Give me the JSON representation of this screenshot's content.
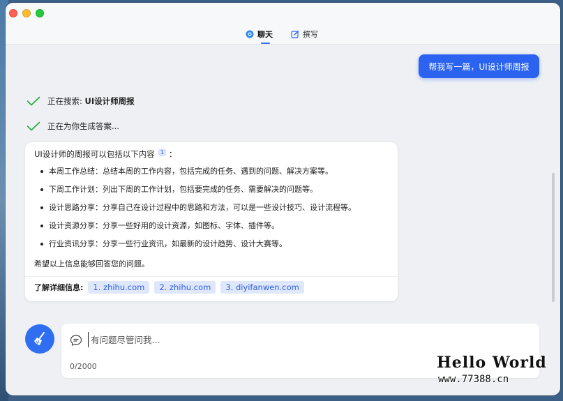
{
  "tabs": [
    {
      "label": "聊天",
      "icon": "chat-bubble-icon",
      "active": true
    },
    {
      "label": "撰写",
      "icon": "edit-icon",
      "active": false
    }
  ],
  "user_message": "帮我写一篇，UI设计师周报",
  "status": {
    "searching_prefix": "正在搜索: ",
    "searching_query": "UI设计师周报",
    "generating": "正在为你生成答案..."
  },
  "answer": {
    "intro": "UI设计师的周报可以包括以下内容",
    "intro_suffix": "：",
    "citation": "1",
    "items": [
      "本周工作总结：总结本周的工作内容，包括完成的任务、遇到的问题、解决方案等。",
      "下周工作计划：列出下周的工作计划，包括要完成的任务、需要解决的问题等。",
      "设计思路分享：分享自己在设计过程中的思路和方法，可以是一些设计技巧、设计流程等。",
      "设计资源分享：分享一些好用的设计资源，如图标、字体、插件等。",
      "行业资讯分享：分享一些行业资讯，如最新的设计趋势、设计大赛等。"
    ],
    "outro": "希望以上信息能够回答您的问题。",
    "sources_label": "了解详细信息:",
    "sources": [
      "1. zhihu.com",
      "2. zhihu.com",
      "3. diyifanwen.com"
    ]
  },
  "input": {
    "placeholder": "有问题尽管问我...",
    "counter": "0/2000"
  },
  "watermark": {
    "title": "Hello World",
    "url": "www.77388.cn"
  },
  "colors": {
    "accent": "#2b63f0",
    "check": "#27a844"
  }
}
